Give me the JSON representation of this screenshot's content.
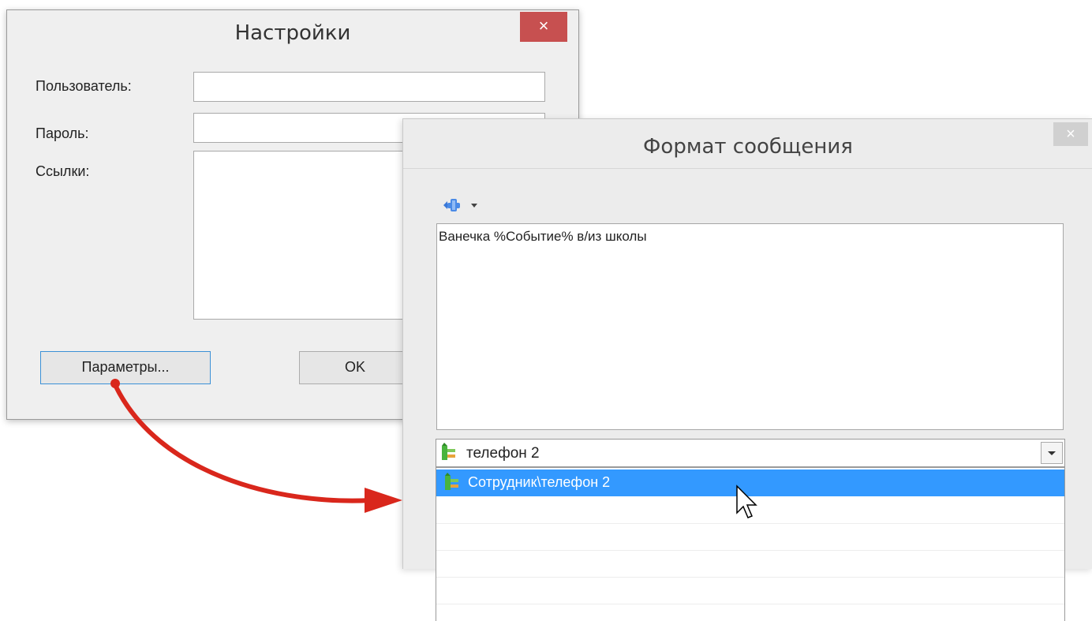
{
  "settings_dialog": {
    "title": "Настройки",
    "close_glyph": "×",
    "user_label": "Пользователь:",
    "password_label": "Пароль:",
    "links_label": "Ссылки:",
    "params_button": "Параметры...",
    "ok_button": "OK"
  },
  "format_dialog": {
    "title": "Формат сообщения",
    "close_glyph": "×",
    "insert_button_icon": "insert-variable-icon",
    "message_text": "Ванечка %Событие% в/из школы",
    "combo_value": "телефон 2",
    "combo_icon": "field-tree-icon",
    "dropdown_items": [
      {
        "label": "Сотрудник\\телефон 2",
        "selected": true
      }
    ]
  },
  "annotation": {
    "arrow_color": "#d9271c"
  },
  "colors": {
    "close_button": "#c75050",
    "selection": "#3399ff",
    "focus_border": "#3b90d6"
  }
}
